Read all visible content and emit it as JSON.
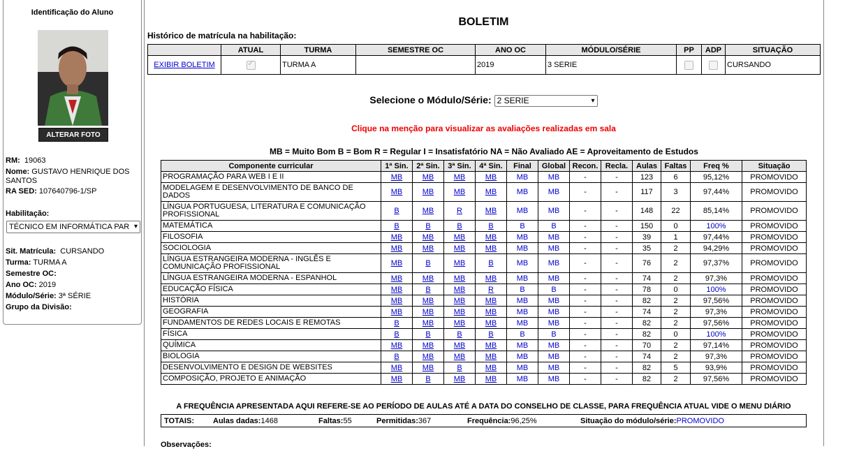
{
  "left": {
    "title": "Identificação do Aluno",
    "alter_photo": "ALTERAR FOTO",
    "rm_label": "RM:",
    "rm": "19063",
    "nome_label": "Nome:",
    "nome": "GUSTAVO HENRIQUE DOS SANTOS",
    "rased_label": "RA SED:",
    "rased": "107640796-1/SP",
    "hab_label": "Habilitação:",
    "hab_value": "TÉCNICO EM INFORMÁTICA PAR",
    "sit_label": "Sit. Matrícula:",
    "sit": "CURSANDO",
    "turma_label": "Turma:",
    "turma": "TURMA A",
    "sem_label": "Semestre OC:",
    "sem": "",
    "ano_label": "Ano OC:",
    "ano": "2019",
    "mod_label": "Módulo/Série:",
    "mod": "3ª SÉRIE",
    "grupo_label": "Grupo da Divisão:",
    "grupo": ""
  },
  "main": {
    "title": "BOLETIM",
    "hist_label": "Histórico de matrícula na habilitação:",
    "hist_headers": [
      "",
      "ATUAL",
      "TURMA",
      "SEMESTRE OC",
      "ANO OC",
      "MÓDULO/SÉRIE",
      "PP",
      "ADP",
      "SITUAÇÃO"
    ],
    "hist_row": {
      "link": "EXIBIR BOLETIM",
      "turma": "TURMA A",
      "semestre": "",
      "ano": "2019",
      "modulo": "3 SERIE",
      "situacao": "CURSANDO"
    },
    "select_label": "Selecione o Módulo/Série:",
    "select_value": "2 SERIE",
    "hint": "Clique na menção para visualizar as avaliações realizadas em sala",
    "legend": "MB = Muito Bom  B = Bom  R = Regular  I = Insatisfatório  NA = Não Avaliado  AE = Aproveitamento de Estudos",
    "grade_headers": [
      "Componente curricular",
      "1ª Sin.",
      "2ª Sin.",
      "3ª Sin.",
      "4ª Sin.",
      "Final",
      "Global",
      "Recon.",
      "Recla.",
      "Aulas",
      "Faltas",
      "Freq %",
      "Situação"
    ],
    "rows": [
      {
        "c": "PROGRAMAÇÃO PARA WEB I E II",
        "s": [
          "MB",
          "MB",
          "MB",
          "MB"
        ],
        "f": "MB",
        "g": "MB",
        "rc": "-",
        "rl": "-",
        "a": "123",
        "fa": "6",
        "fr": "95,12%",
        "st": "PROMOVIDO"
      },
      {
        "c": "MODELAGEM E DESENVOLVIMENTO DE BANCO DE DADOS",
        "s": [
          "MB",
          "MB",
          "MB",
          "MB"
        ],
        "f": "MB",
        "g": "MB",
        "rc": "-",
        "rl": "-",
        "a": "117",
        "fa": "3",
        "fr": "97,44%",
        "st": "PROMOVIDO"
      },
      {
        "c": "LÍNGUA PORTUGUESA, LITERATURA E COMUNICAÇÃO PROFISSIONAL",
        "s": [
          "B",
          "MB",
          "R",
          "MB"
        ],
        "f": "MB",
        "g": "MB",
        "rc": "-",
        "rl": "-",
        "a": "148",
        "fa": "22",
        "fr": "85,14%",
        "st": "PROMOVIDO"
      },
      {
        "c": "MATEMÁTICA",
        "s": [
          "B",
          "B",
          "B",
          "B"
        ],
        "f": "B",
        "g": "B",
        "rc": "-",
        "rl": "-",
        "a": "150",
        "fa": "0",
        "fr": "100%",
        "st": "PROMOVIDO"
      },
      {
        "c": "FILOSOFIA",
        "s": [
          "MB",
          "MB",
          "MB",
          "MB"
        ],
        "f": "MB",
        "g": "MB",
        "rc": "-",
        "rl": "-",
        "a": "39",
        "fa": "1",
        "fr": "97,44%",
        "st": "PROMOVIDO"
      },
      {
        "c": "SOCIOLOGIA",
        "s": [
          "MB",
          "MB",
          "MB",
          "MB"
        ],
        "f": "MB",
        "g": "MB",
        "rc": "-",
        "rl": "-",
        "a": "35",
        "fa": "2",
        "fr": "94,29%",
        "st": "PROMOVIDO"
      },
      {
        "c": "LÍNGUA ESTRANGEIRA MODERNA - INGLÊS E COMUNICAÇÃO PROFISSIONAL",
        "s": [
          "MB",
          "B",
          "MB",
          "B"
        ],
        "f": "MB",
        "g": "MB",
        "rc": "-",
        "rl": "-",
        "a": "76",
        "fa": "2",
        "fr": "97,37%",
        "st": "PROMOVIDO"
      },
      {
        "c": "LÍNGUA ESTRANGEIRA MODERNA - ESPANHOL",
        "s": [
          "MB",
          "MB",
          "MB",
          "MB"
        ],
        "f": "MB",
        "g": "MB",
        "rc": "-",
        "rl": "-",
        "a": "74",
        "fa": "2",
        "fr": "97,3%",
        "st": "PROMOVIDO"
      },
      {
        "c": "EDUCAÇÃO FÍSICA",
        "s": [
          "MB",
          "B",
          "MB",
          "R"
        ],
        "f": "B",
        "g": "B",
        "rc": "-",
        "rl": "-",
        "a": "78",
        "fa": "0",
        "fr": "100%",
        "st": "PROMOVIDO"
      },
      {
        "c": "HISTÓRIA",
        "s": [
          "MB",
          "MB",
          "MB",
          "MB"
        ],
        "f": "MB",
        "g": "MB",
        "rc": "-",
        "rl": "-",
        "a": "82",
        "fa": "2",
        "fr": "97,56%",
        "st": "PROMOVIDO"
      },
      {
        "c": "GEOGRAFIA",
        "s": [
          "MB",
          "MB",
          "MB",
          "MB"
        ],
        "f": "MB",
        "g": "MB",
        "rc": "-",
        "rl": "-",
        "a": "74",
        "fa": "2",
        "fr": "97,3%",
        "st": "PROMOVIDO"
      },
      {
        "c": "FUNDAMENTOS DE REDES LOCAIS E REMOTAS",
        "s": [
          "B",
          "MB",
          "MB",
          "MB"
        ],
        "f": "MB",
        "g": "MB",
        "rc": "-",
        "rl": "-",
        "a": "82",
        "fa": "2",
        "fr": "97,56%",
        "st": "PROMOVIDO"
      },
      {
        "c": "FÍSICA",
        "s": [
          "B",
          "B",
          "B",
          "B"
        ],
        "f": "B",
        "g": "B",
        "rc": "-",
        "rl": "-",
        "a": "82",
        "fa": "0",
        "fr": "100%",
        "st": "PROMOVIDO"
      },
      {
        "c": "QUÍMICA",
        "s": [
          "MB",
          "MB",
          "MB",
          "MB"
        ],
        "f": "MB",
        "g": "MB",
        "rc": "-",
        "rl": "-",
        "a": "70",
        "fa": "2",
        "fr": "97,14%",
        "st": "PROMOVIDO"
      },
      {
        "c": "BIOLOGIA",
        "s": [
          "B",
          "MB",
          "MB",
          "MB"
        ],
        "f": "MB",
        "g": "MB",
        "rc": "-",
        "rl": "-",
        "a": "74",
        "fa": "2",
        "fr": "97,3%",
        "st": "PROMOVIDO"
      },
      {
        "c": "DESENVOLVIMENTO E DESIGN DE WEBSITES",
        "s": [
          "MB",
          "MB",
          "B",
          "MB"
        ],
        "f": "MB",
        "g": "MB",
        "rc": "-",
        "rl": "-",
        "a": "82",
        "fa": "5",
        "fr": "93,9%",
        "st": "PROMOVIDO"
      },
      {
        "c": "COMPOSIÇÃO, PROJETO E ANIMAÇÃO",
        "s": [
          "MB",
          "B",
          "MB",
          "MB"
        ],
        "f": "MB",
        "g": "MB",
        "rc": "-",
        "rl": "-",
        "a": "82",
        "fa": "2",
        "fr": "97,56%",
        "st": "PROMOVIDO"
      }
    ],
    "freq_note": "A FREQUÊNCIA APRESENTADA AQUI REFERE-SE AO PERÍODO DE AULAS ATÉ A DATA DO CONSELHO DE CLASSE, PARA FREQUÊNCIA ATUAL VIDE O MENU DIÁRIO",
    "totals": {
      "label": "TOTAIS:",
      "aulas_label": "Aulas dadas:",
      "aulas": "1468",
      "faltas_label": "Faltas:",
      "faltas": "55",
      "perm_label": "Permitidas:",
      "perm": "367",
      "freq_label": "Frequência:",
      "freq": "96,25%",
      "sit_label": "Situação do módulo/série:",
      "sit": "PROMOVIDO"
    },
    "obs_label": "Observações:"
  },
  "colors": {
    "link": "#0000cc",
    "hint": "#ee0000",
    "header_bg": "#e6e6e6"
  }
}
